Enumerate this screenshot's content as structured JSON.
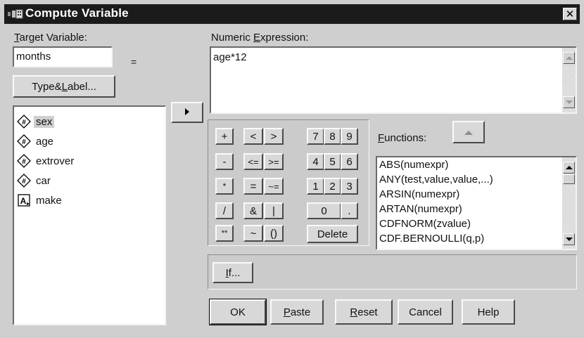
{
  "window": {
    "title": "Compute Variable",
    "close_glyph": "✕"
  },
  "target": {
    "label": "Target Variable:",
    "value": "months",
    "equals": "=",
    "type_label_button": "Type&Label..."
  },
  "expression": {
    "label": "Numeric Expression:",
    "value": "age*12"
  },
  "variables": [
    {
      "name": "sex",
      "type": "numeric",
      "selected": true
    },
    {
      "name": "age",
      "type": "numeric",
      "selected": false
    },
    {
      "name": "extrover",
      "type": "numeric",
      "selected": false
    },
    {
      "name": "car",
      "type": "numeric",
      "selected": false
    },
    {
      "name": "make",
      "type": "string",
      "selected": false
    }
  ],
  "transfer_icon": "right-arrow-icon",
  "keypad": {
    "plus": "+",
    "lt": "<",
    "gt": ">",
    "minus": "-",
    "le": "<=",
    "ge": ">=",
    "times": "*",
    "eq": "=",
    "ne": "~=",
    "divide": "/",
    "and": "&",
    "or": "|",
    "power": "**",
    "not": "~",
    "parens": "()",
    "d7": "7",
    "d8": "8",
    "d9": "9",
    "d4": "4",
    "d5": "5",
    "d6": "6",
    "d1": "1",
    "d2": "2",
    "d3": "3",
    "d0": "0",
    "dot": ".",
    "delete": "Delete"
  },
  "functions": {
    "label": "Functions:",
    "items": [
      "ABS(numexpr)",
      "ANY(test,value,value,...)",
      "ARSIN(numexpr)",
      "ARTAN(numexpr)",
      "CDFNORM(zvalue)",
      "CDF.BERNOULLI(q,p)"
    ]
  },
  "if_button": "If...",
  "buttons": {
    "ok": "OK",
    "paste": "Paste",
    "reset": "Reset",
    "cancel": "Cancel",
    "help": "Help"
  }
}
